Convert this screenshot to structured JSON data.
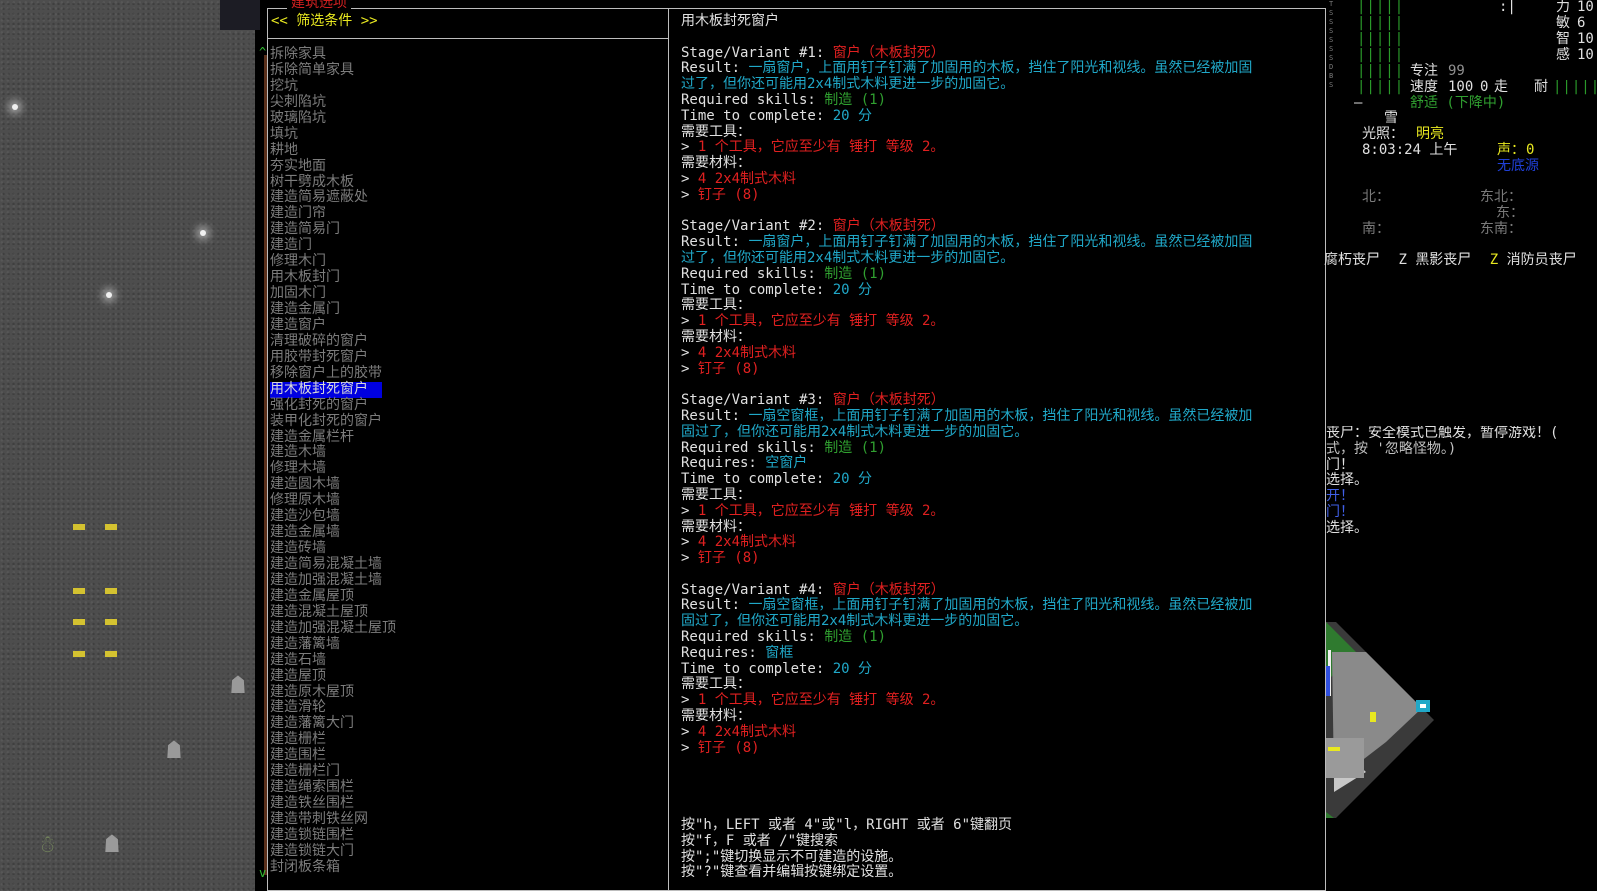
{
  "window": {
    "title": "建筑选项",
    "filter_label": "<< 筛选条件 >>"
  },
  "construction_list": [
    "拆除家具",
    "拆除简单家具",
    "挖坑",
    "尖刺陷坑",
    "玻璃陷坑",
    "填坑",
    "耕地",
    "夯实地面",
    "树干劈成木板",
    "建造简易遮蔽处",
    "建造门帘",
    "建造简易门",
    "建造门",
    "修理木门",
    "用木板封门",
    "加固木门",
    "建造金属门",
    "建造窗户",
    "清理破碎的窗户",
    "用胶带封死窗户",
    "移除窗户上的胶带",
    "用木板封死窗户",
    "强化封死的窗户",
    "装甲化封死的窗户",
    "建造金属栏杆",
    "建造木墙",
    "修理木墙",
    "建造圆木墙",
    "修理原木墙",
    "建造沙包墙",
    "建造金属墙",
    "建造砖墙",
    "建造简易混凝土墙",
    "建造加强混凝土墙",
    "建造金属屋顶",
    "建造混凝土屋顶",
    "建造加强混凝土屋顶",
    "建造藩篱墙",
    "建造石墙",
    "建造屋顶",
    "建造原木屋顶",
    "建造滑轮",
    "建造藩篱大门",
    "建造栅栏",
    "建造围栏",
    "建造栅栏门",
    "建造绳索围栏",
    "建造铁丝围栏",
    "建造带刺铁丝网",
    "建造锁链围栏",
    "建造锁链大门",
    "封闭板条箱"
  ],
  "selected_index": 21,
  "detail": {
    "heading": "用木板封死窗户",
    "labels": {
      "result": "Result: ",
      "skills": "Required skills: ",
      "requires": "Requires: ",
      "time": "Time to complete: ",
      "tools": "需要工具：",
      "materials": "需要材料："
    },
    "stages": [
      {
        "title": "Stage/Variant #1: ",
        "name": "窗户（木板封死）",
        "result_1": "一扇窗户，上面用钉子钉满了加固用的木板，挡住了阳光和视线。虽然已经被加固",
        "result_2": "过了，但你还可能用2x4制式木料更进一步的加固它。",
        "skill": "制造 (1)",
        "requires": "",
        "time": "20 分",
        "tool": "1 个工具，它应至少有 锤打 等级 2。",
        "material_1": "4 2x4制式木料",
        "material_2": "钉子 (8)"
      },
      {
        "title": "Stage/Variant #2: ",
        "name": "窗户（木板封死）",
        "result_1": "一扇窗户，上面用钉子钉满了加固用的木板，挡住了阳光和视线。虽然已经被加固",
        "result_2": "过了，但你还可能用2x4制式木料更进一步的加固它。",
        "skill": "制造 (1)",
        "requires": "",
        "time": "20 分",
        "tool": "1 个工具，它应至少有 锤打 等级 2。",
        "material_1": "4 2x4制式木料",
        "material_2": "钉子 (8)"
      },
      {
        "title": "Stage/Variant #3: ",
        "name": "窗户（木板封死）",
        "result_1": "一扇空窗框，上面用钉子钉满了加固用的木板，挡住了阳光和视线。虽然已经被加",
        "result_2": "固过了，但你还可能用2x4制式木料更进一步的加固它。",
        "skill": "制造 (1)",
        "requires": "空窗户",
        "time": "20 分",
        "tool": "1 个工具，它应至少有 锤打 等级 2。",
        "material_1": "4 2x4制式木料",
        "material_2": "钉子 (8)"
      },
      {
        "title": "Stage/Variant #4: ",
        "name": "窗户（木板封死）",
        "result_1": "一扇空窗框，上面用钉子钉满了加固用的木板，挡住了阳光和视线。虽然已经被加",
        "result_2": "固过了，但你还可能用2x4制式木料更进一步的加固它。",
        "skill": "制造 (1)",
        "requires": "窗框",
        "time": "20 分",
        "tool": "1 个工具，它应至少有 锤打 等级 2。",
        "material_1": "4 2x4制式木料",
        "material_2": "钉子 (8)"
      }
    ]
  },
  "help": [
    "按\"h，LEFT 或者 4\"或\"l，RIGHT 或者 6\"键翻页",
    "按\"f，F 或者 /\"键搜索",
    "按\";\"键切换显示不可建造的设施。",
    "按\"?\"键查看并编辑按键绑定设置。"
  ],
  "sidebar": {
    "bars": "|||||",
    "stat_str_label": "力",
    "stat_str": "10",
    "stat_dex_label": "敏",
    "stat_dex": "6",
    "stat_int_label": "智",
    "stat_int": "10",
    "stat_per_label": "感",
    "stat_per": "10",
    "colon_pipe": ":|",
    "focus_label": "专注",
    "focus": "99",
    "speed_label": "速度",
    "speed": "100",
    "move_zero": "0",
    "move_label": "走",
    "stamina_label": "耐",
    "stamina_bars": "|||||",
    "comfort": "舒适 (下降中)",
    "dash": "—",
    "weather": "雪",
    "light_label": "光照：",
    "light": "明亮",
    "time": "8:03:24 上午",
    "sound_label": "声：",
    "sound": "0",
    "sound_source": "无底源",
    "dir_n": "北：",
    "dir_ne": "东北：",
    "dir_e": "东：",
    "dir_s": "南：",
    "dir_se": "东南：",
    "monsters": [
      {
        "prefix": "",
        "name": "腐朽丧尸"
      },
      {
        "prefix": "Z",
        "name": "黑影丧尸"
      },
      {
        "prefix": "Z",
        "name": "消防员丧尸"
      }
    ],
    "log": [
      "丧尸：安全模式已触发，暂停游戏！(",
      "式，按 '忽略怪物。)",
      "门！",
      "选择。",
      "开！",
      "门！",
      "选择。"
    ]
  }
}
